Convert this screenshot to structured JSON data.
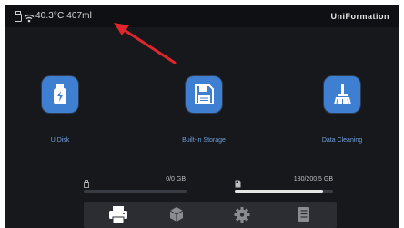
{
  "status": {
    "temperature": "40.3°C",
    "volume": "407ml",
    "brand": "UniFormation"
  },
  "apps": [
    {
      "label": "U Disk",
      "icon": "usb-drive-icon"
    },
    {
      "label": "Built-in Storage",
      "icon": "floppy-disk-icon"
    },
    {
      "label": "Data Cleaning",
      "icon": "broom-icon"
    }
  ],
  "storage": {
    "usb": {
      "text": "0/0 GB",
      "fraction": 0,
      "icon": "usb-stick-icon"
    },
    "internal": {
      "text": "180/200.5 GB",
      "fraction": 0.9,
      "icon": "sd-card-icon"
    }
  },
  "nav": [
    {
      "icon": "printer-icon",
      "active": true
    },
    {
      "icon": "cube-icon",
      "active": false
    },
    {
      "icon": "gear-icon",
      "active": false
    },
    {
      "icon": "document-icon",
      "active": false
    }
  ],
  "colors": {
    "accent": "#3f7fd1",
    "label": "#6f9fdc",
    "annotation": "#e0262c"
  }
}
